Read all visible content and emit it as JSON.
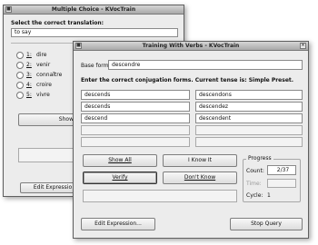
{
  "windows": {
    "multiple_choice": {
      "title": "Multiple Choice - KVocTrain",
      "prompt": "Select the correct translation:",
      "question": "to say",
      "choices": [
        {
          "number": "1:",
          "text": "dire"
        },
        {
          "number": "2:",
          "text": "venir"
        },
        {
          "number": "3:",
          "text": "connaître"
        },
        {
          "number": "4:",
          "text": "croire"
        },
        {
          "number": "5:",
          "text": "vivre"
        }
      ],
      "show_all_label": "Show A",
      "edit_expression_label": "Edit Expressio"
    },
    "verbs": {
      "title": "Training With Verbs - KVocTrain",
      "base_form_label": "Base form:",
      "base_form_value": "descendre",
      "instruction": "Enter the correct conjugation forms.   Current tense is: Simple Preset.",
      "conjugations": {
        "left": [
          "descends",
          "descends",
          "descend",
          "",
          ""
        ],
        "right": [
          "descendons",
          "descendez",
          "descendent",
          "",
          ""
        ]
      },
      "buttons": {
        "show_all": "Show All",
        "i_know_it": "I Know It",
        "verify": "Verify",
        "dont_know": "Don't Know",
        "edit_expression": "Edit Expression...",
        "stop_query": "Stop Query"
      },
      "progress": {
        "title": "Progress",
        "count_label": "Count:",
        "count_value": "2/37",
        "time_label": "Time:",
        "cycle_label": "Cycle:",
        "cycle_value": "1"
      }
    }
  }
}
